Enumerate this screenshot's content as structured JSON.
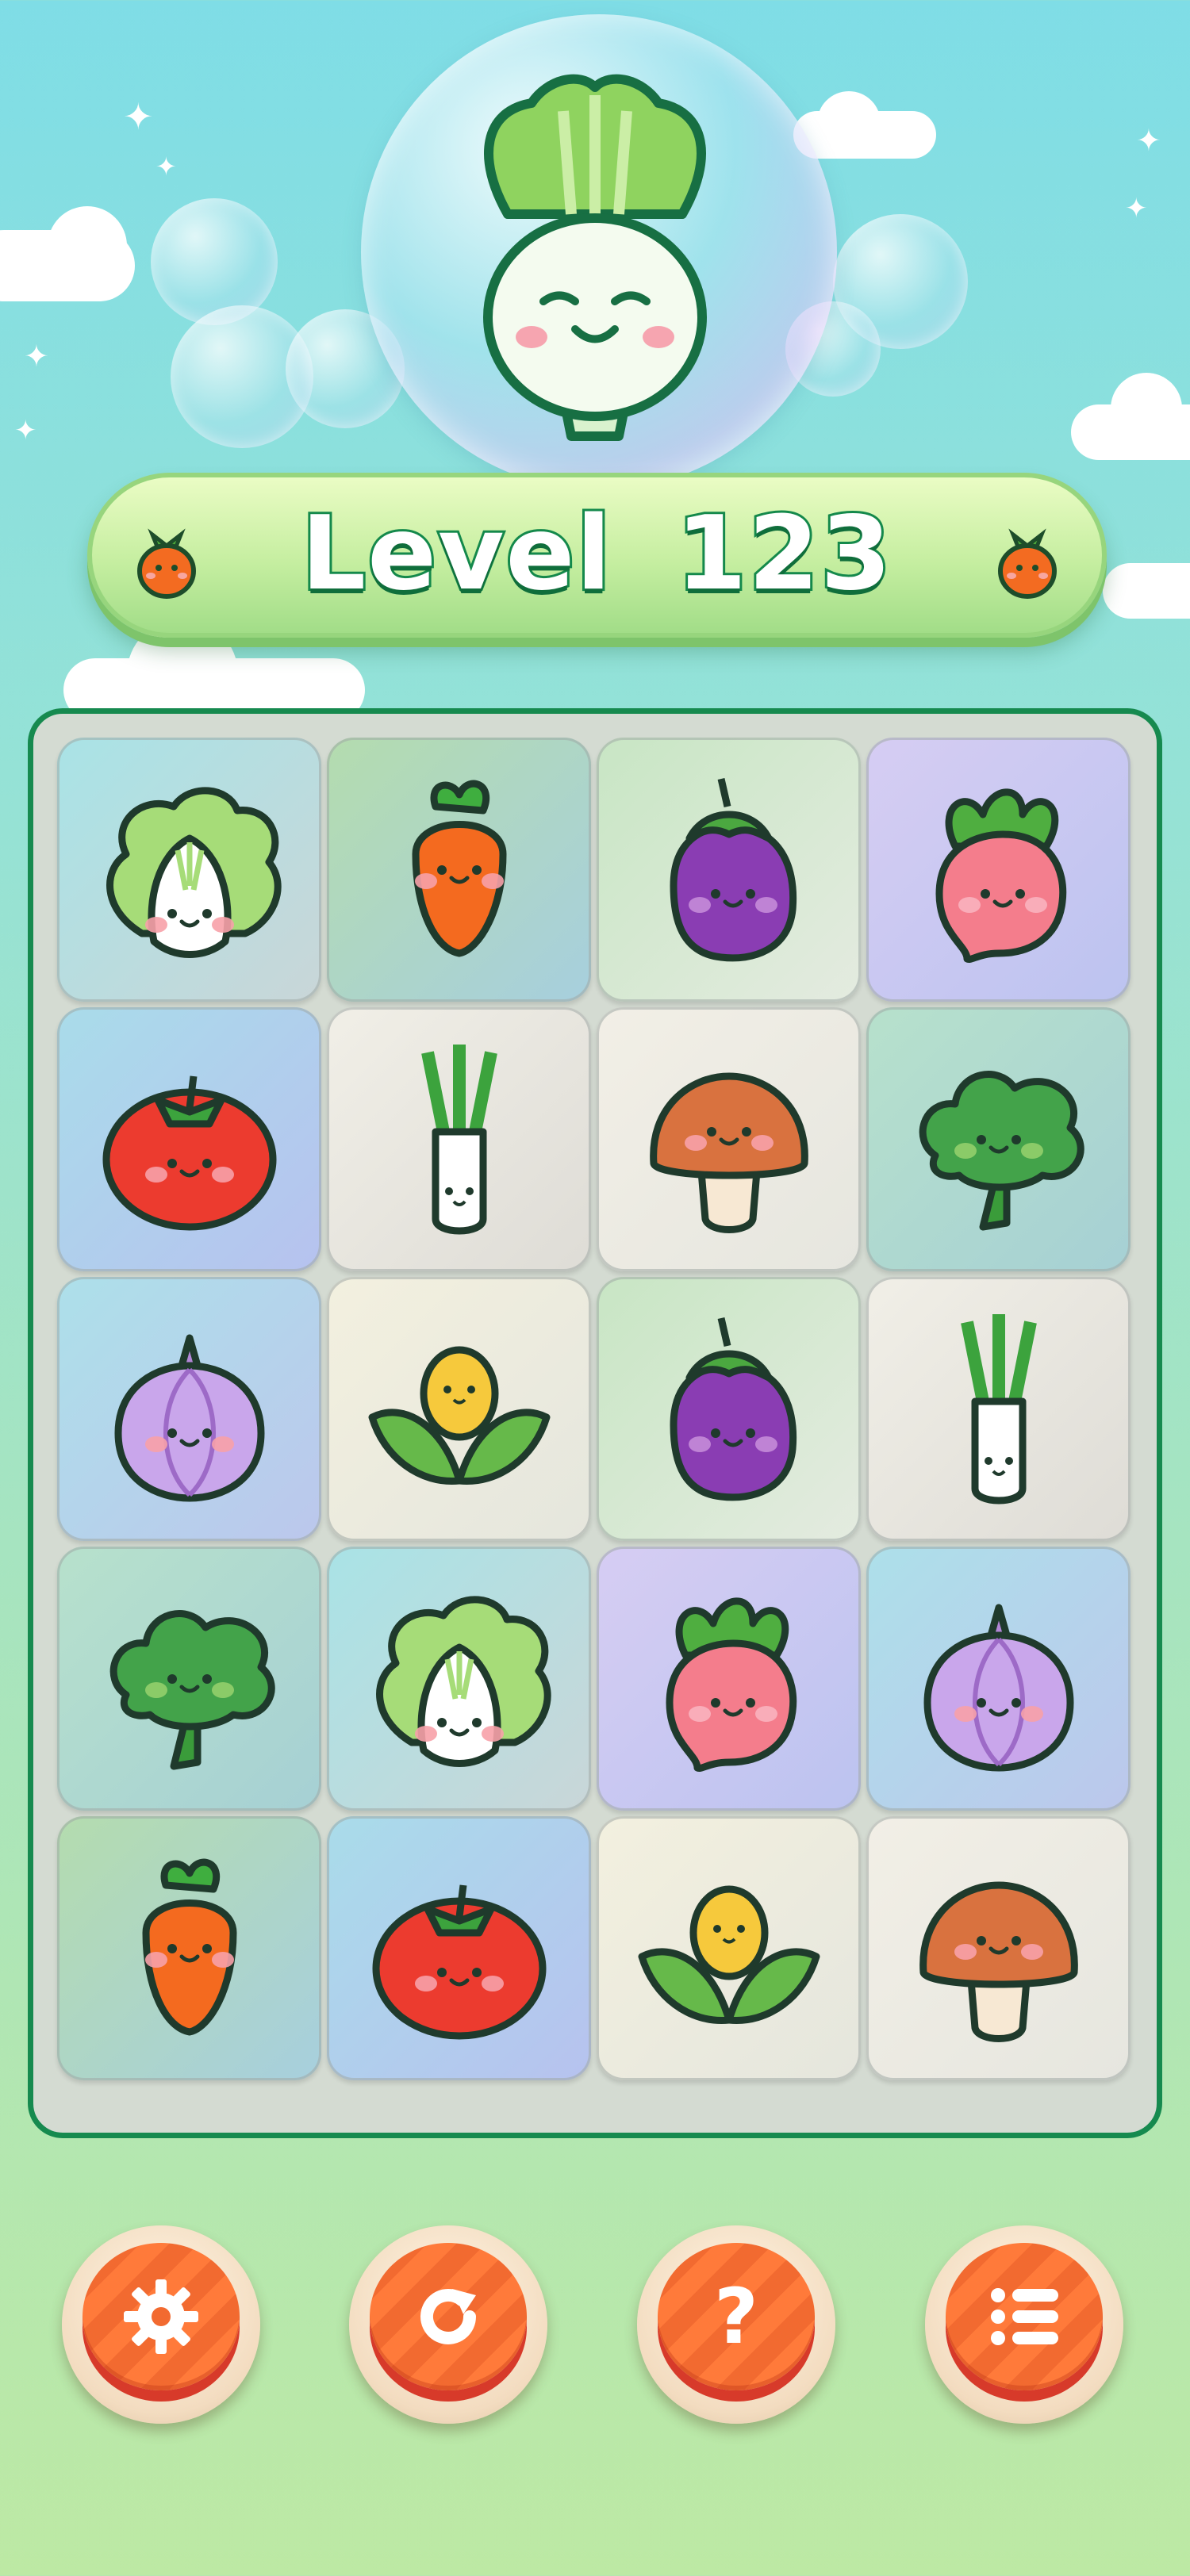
{
  "level": {
    "label": "Level",
    "number": "123"
  },
  "hero": {
    "icon": "smiling-onion-icon"
  },
  "board": {
    "rows": 5,
    "cols": 4,
    "tiles": [
      [
        "cabbage",
        "carrot",
        "eggplant",
        "radish"
      ],
      [
        "tomato",
        "leek",
        "mushroom",
        "broccoli"
      ],
      [
        "onion",
        "corn",
        "eggplant",
        "leek"
      ],
      [
        "broccoli",
        "cabbage",
        "radish",
        "onion"
      ],
      [
        "carrot",
        "tomato",
        "corn",
        "mushroom"
      ]
    ]
  },
  "buttons": [
    {
      "name": "settings-button",
      "icon": "gear-icon"
    },
    {
      "name": "restart-button",
      "icon": "restart-icon"
    },
    {
      "name": "help-button",
      "icon": "question-icon"
    },
    {
      "name": "menu-button",
      "icon": "list-icon"
    }
  ],
  "colors": {
    "accent_green": "#168a4f",
    "button_orange": "#f26a30",
    "board_bg": "#d4dbd2"
  }
}
